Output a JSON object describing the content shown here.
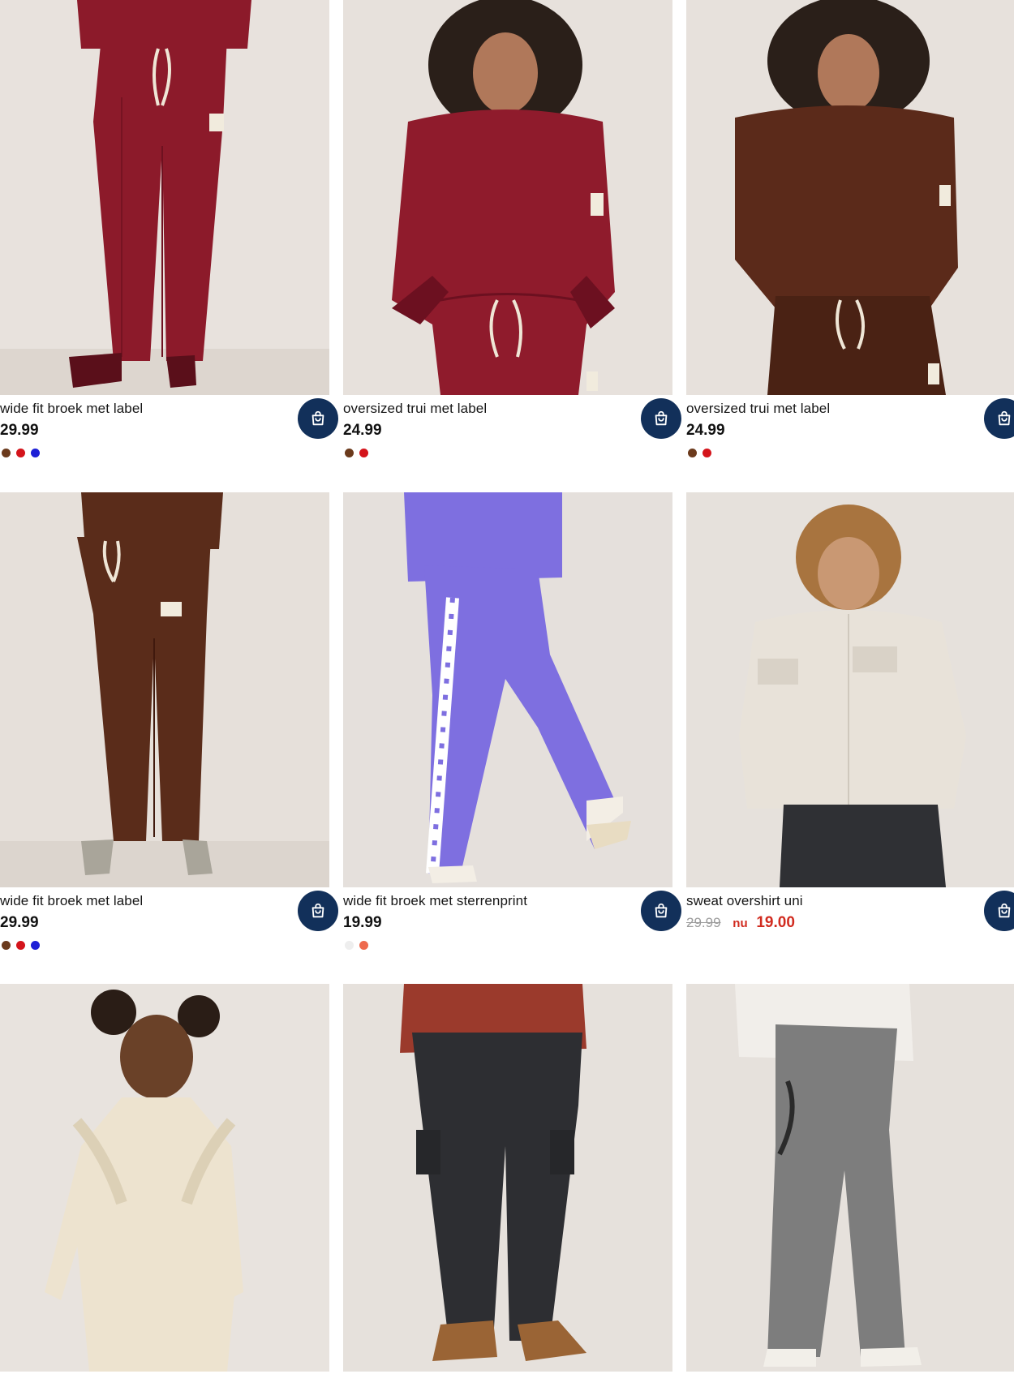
{
  "products": [
    {
      "title": "wide fit broek met label",
      "price": "29.99",
      "swatches": [
        "#6b3a1c",
        "#d4141b",
        "#1d1fd6"
      ],
      "image": "woman-maroon-wide-pants",
      "colors": {
        "bg": "#e8e2dd",
        "cloth": "#8c1a2a",
        "shade": "#6e1120"
      }
    },
    {
      "title": "oversized trui met label",
      "price": "24.99",
      "swatches": [
        "#6b3a1c",
        "#d4141b"
      ],
      "image": "woman-maroon-sweater",
      "colors": {
        "bg": "#e7e1dc",
        "cloth": "#8f1b2c",
        "shade": "#6c1020"
      }
    },
    {
      "title": "oversized trui met label",
      "price": "24.99",
      "swatches": [
        "#6b3a1c",
        "#d4141b"
      ],
      "image": "woman-brown-sweater",
      "colors": {
        "bg": "#e7e1dc",
        "cloth": "#5b2a1a",
        "shade": "#42190e"
      }
    },
    {
      "title": "wide fit broek met label",
      "price": "29.99",
      "swatches": [
        "#6b3a1c",
        "#d4141b",
        "#1d1fd6"
      ],
      "image": "girl-brown-wide-pants",
      "colors": {
        "bg": "#e6e0da",
        "cloth": "#5a2c1a",
        "shade": "#40190d"
      }
    },
    {
      "title": "wide fit broek met sterrenprint",
      "price": "19.99",
      "swatches": [
        "#eeeeee",
        "#ee6a4e"
      ],
      "image": "child-purple-star-pants",
      "colors": {
        "bg": "#e5e0dc",
        "cloth": "#7e6fe0",
        "shade": "#6256c6"
      }
    },
    {
      "title": "sweat overshirt uni",
      "old_price": "29.99",
      "now_label": "nu",
      "new_price": "19.00",
      "swatches": [],
      "image": "boy-cream-overshirt",
      "colors": {
        "bg": "#e6e1dc",
        "cloth": "#e8e2d9",
        "shade": "#cfc8bd"
      }
    },
    {
      "title": "",
      "price": "",
      "swatches": [],
      "image": "girl-cream-knit-dress",
      "colors": {
        "bg": "#e8e3de",
        "cloth": "#ede3cf",
        "shade": "#d9ccb3"
      }
    },
    {
      "title": "",
      "price": "",
      "swatches": [],
      "image": "boy-black-cargo-jeans",
      "colors": {
        "bg": "#e6e1dc",
        "cloth": "#2d2e32",
        "shade": "#1d1e21"
      }
    },
    {
      "title": "",
      "price": "",
      "swatches": [],
      "image": "girl-grey-flared-jeans",
      "colors": {
        "bg": "#e6e1dc",
        "cloth": "#7d7d7d",
        "shade": "#5f5f5f"
      }
    }
  ],
  "cart_icon": "shopping-bag-icon"
}
